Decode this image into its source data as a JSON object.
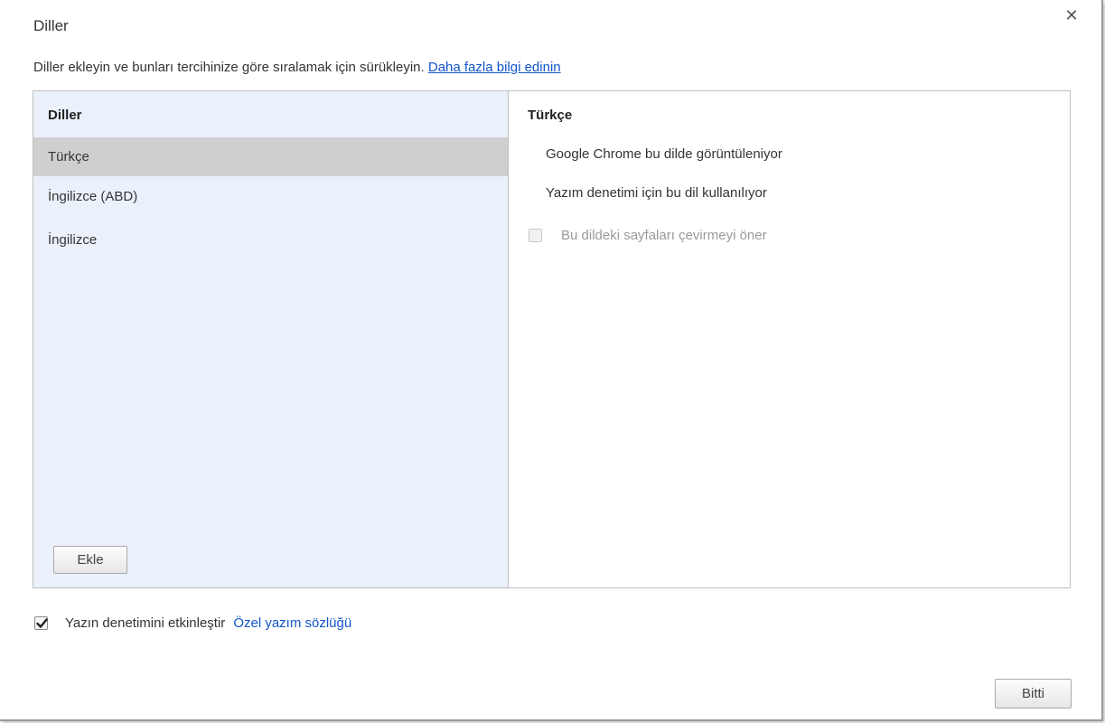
{
  "dialog": {
    "title": "Diller",
    "close_icon": "close-icon",
    "intro_text": "Diller ekleyin ve bunları tercihinize göre sıralamak için sürükleyin.",
    "intro_link": "Daha fazla bilgi edinin"
  },
  "languages": {
    "header": "Diller",
    "items": [
      {
        "label": "Türkçe",
        "selected": true
      },
      {
        "label": "İngilizce (ABD)",
        "selected": false
      },
      {
        "label": "İngilizce",
        "selected": false
      }
    ],
    "add_button": "Ekle"
  },
  "details": {
    "title": "Türkçe",
    "display_info": "Google Chrome bu dilde görüntüleniyor",
    "spellcheck_info": "Yazım denetimi için bu dil kullanılıyor",
    "translate_option": {
      "label": "Bu dildeki sayfaları çevirmeyi öner",
      "checked": false,
      "disabled": true
    }
  },
  "footer": {
    "spellcheck": {
      "label": "Yazın denetimini etkinleştir",
      "checked": true
    },
    "custom_dictionary_link": "Özel yazım sözlüğü",
    "done_button": "Bitti"
  },
  "colors": {
    "list_background": "#ebf1fb",
    "selected_item": "#cfcfcf",
    "link": "#1155cc"
  }
}
